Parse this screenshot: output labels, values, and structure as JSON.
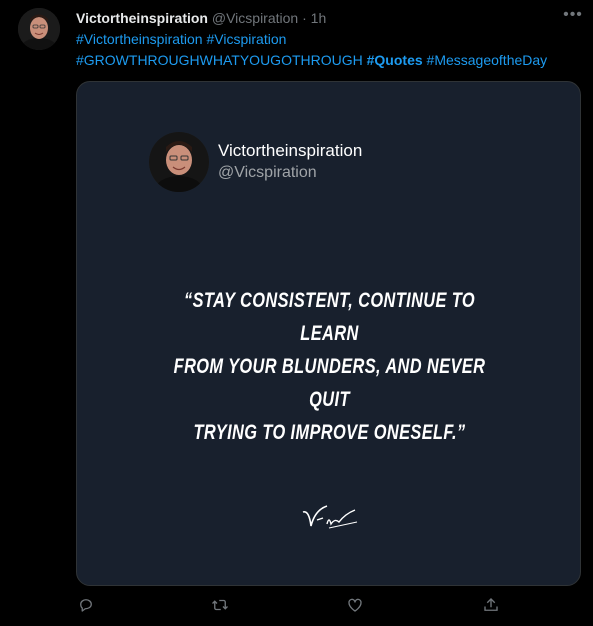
{
  "tweet": {
    "author_name": "Victortheinspiration",
    "author_handle": "@Vicspiration",
    "separator": "·",
    "time": "1h",
    "hashtags_line1": [
      "#Victortheinspiration",
      "#Vicspiration"
    ],
    "hashtags_line2": [
      "#GROWTHROUGHWHATYOUGOTHROUGH",
      "#Quotes",
      "#MessageoftheDay"
    ]
  },
  "card": {
    "name": "Victortheinspiration",
    "handle": "@Vicspiration",
    "quote_lines": [
      "“STAY CONSISTENT, CONTINUE TO LEARN",
      "FROM YOUR BLUNDERS, AND NEVER QUIT",
      "TRYING TO IMPROVE ONESELF.”"
    ],
    "signature": "Vic"
  },
  "actions": [
    "reply-icon",
    "retweet-icon",
    "like-icon",
    "share-icon"
  ],
  "colors": {
    "background": "#000000",
    "link": "#1d9bf0",
    "muted": "#71767b",
    "card_bg": "#18202d"
  }
}
